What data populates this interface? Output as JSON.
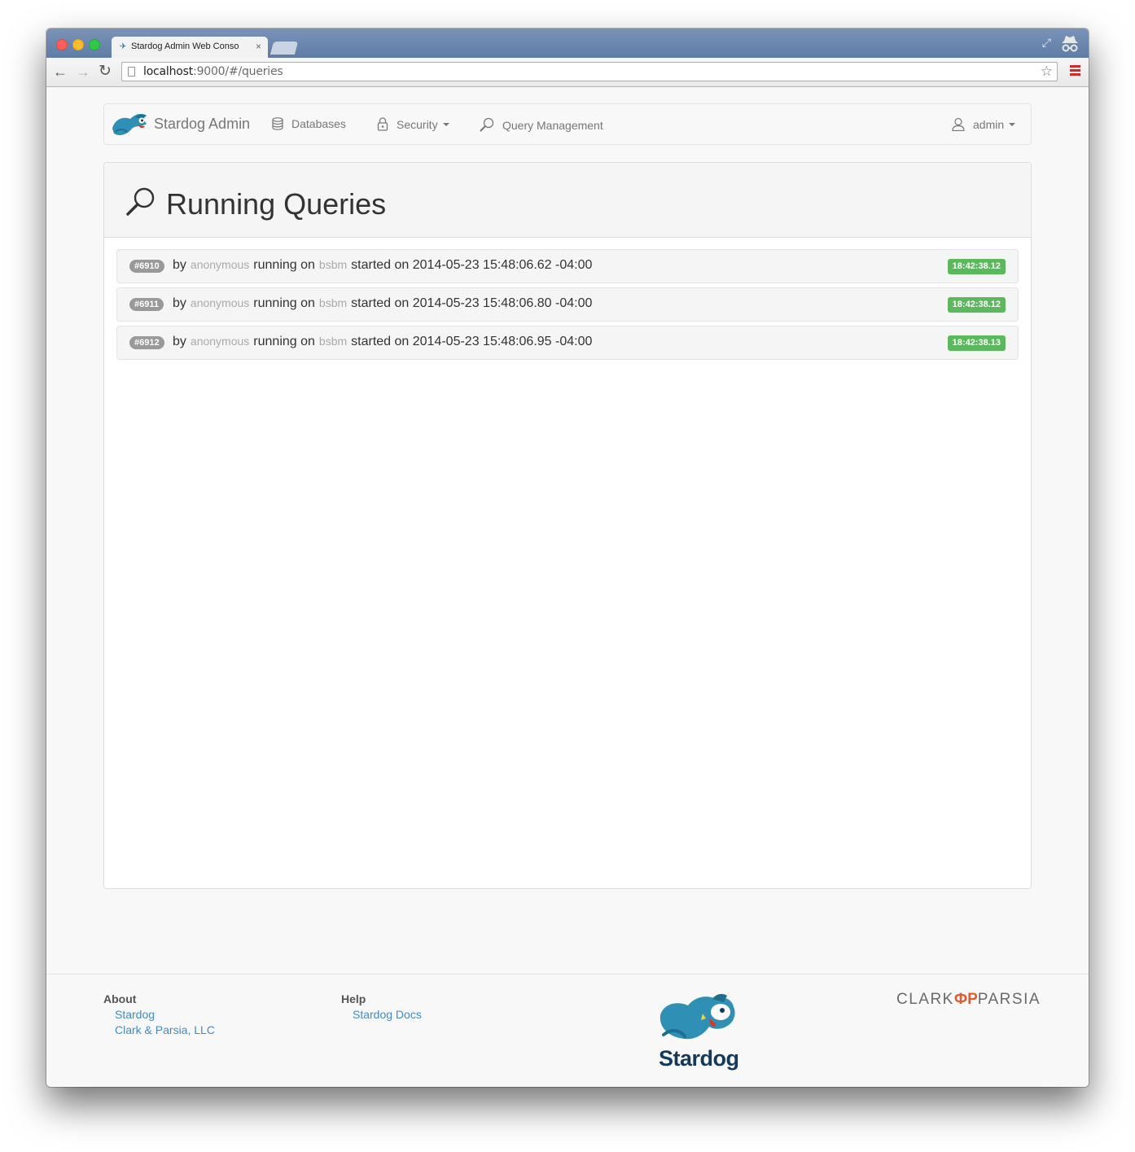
{
  "browser": {
    "tab_title": "Stardog Admin Web Conso",
    "tab_close": "×",
    "url_host": "localhost",
    "url_rest": ":9000/#/queries"
  },
  "navbar": {
    "brand": "Stardog Admin",
    "items": [
      {
        "label": "Databases",
        "icon": "database-icon"
      },
      {
        "label": "Security",
        "icon": "lock-icon",
        "dropdown": true
      },
      {
        "label": "Query Management",
        "icon": "search-icon"
      }
    ],
    "user": {
      "label": "admin",
      "icon": "user-icon"
    }
  },
  "panel": {
    "title": "Running Queries",
    "icon": "search-icon"
  },
  "queries": [
    {
      "id": "#6910",
      "by": "by",
      "user": "anonymous",
      "running_on": "running on",
      "db": "bsbm",
      "started_on": "started on 2014-05-23 15:48:06.62 -04:00",
      "elapsed": "18:42:38.12"
    },
    {
      "id": "#6911",
      "by": "by",
      "user": "anonymous",
      "running_on": "running on",
      "db": "bsbm",
      "started_on": "started on 2014-05-23 15:48:06.80 -04:00",
      "elapsed": "18:42:38.12"
    },
    {
      "id": "#6912",
      "by": "by",
      "user": "anonymous",
      "running_on": "running on",
      "db": "bsbm",
      "started_on": "started on 2014-05-23 15:48:06.95 -04:00",
      "elapsed": "18:42:38.13"
    }
  ],
  "footer": {
    "about": {
      "heading": "About",
      "links": [
        "Stardog",
        "Clark & Parsia, LLC"
      ]
    },
    "help": {
      "heading": "Help",
      "links": [
        "Stardog Docs"
      ]
    },
    "logo_text": "Stardog",
    "partner_left": "CLARK",
    "partner_right": "PARSIA"
  },
  "colors": {
    "accent_link": "#428bca",
    "label_success": "#5cb85c",
    "label_default": "#999999"
  }
}
